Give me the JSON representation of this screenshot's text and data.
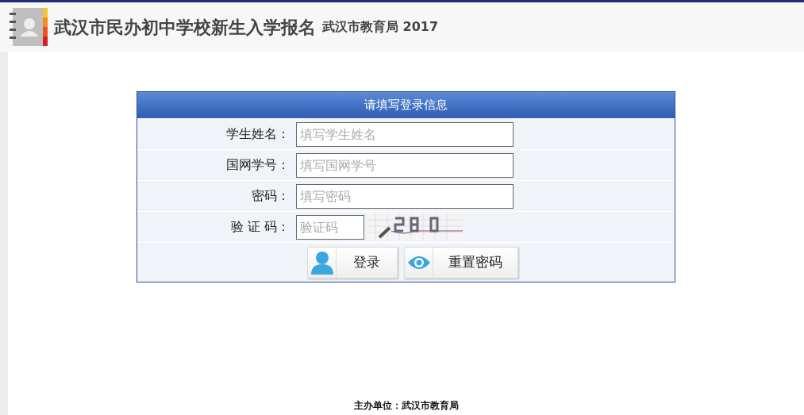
{
  "header": {
    "title": "武汉市民办初中学校新生入学报名",
    "subtitle": "武汉市教育局 2017"
  },
  "form": {
    "title": "请填写登录信息",
    "fields": [
      {
        "kind": "text",
        "label": "学生姓名：",
        "placeholder": "填写学生姓名"
      },
      {
        "kind": "text",
        "label": "国网学号：",
        "placeholder": "填写国网学号"
      },
      {
        "kind": "password",
        "label": "密码：",
        "placeholder": "填写密码"
      },
      {
        "kind": "captcha",
        "label": "验 证 码：",
        "placeholder": "验证码"
      }
    ],
    "buttons": [
      {
        "kind": "login",
        "label": "登录"
      },
      {
        "kind": "reset",
        "label": "重置密码"
      }
    ]
  },
  "footer": {
    "text": "主办单位：武汉市教育局"
  }
}
